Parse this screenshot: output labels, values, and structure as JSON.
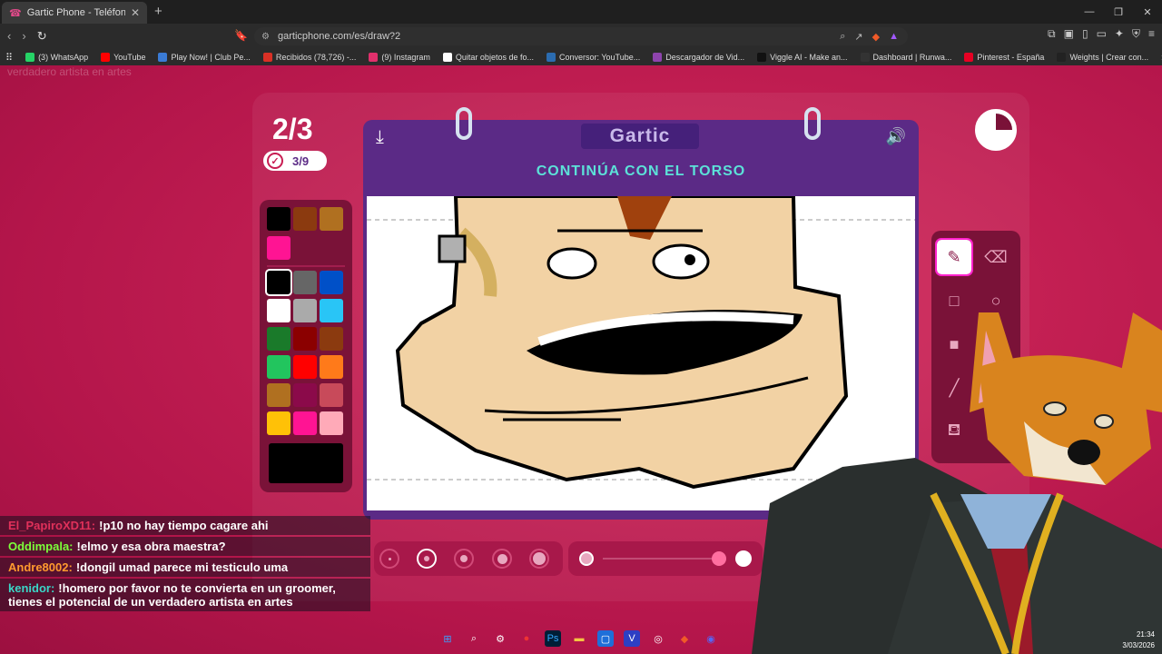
{
  "browser": {
    "tab_title": "Gartic Phone - Teléfono Descon",
    "url": "garticphone.com/es/draw?2",
    "bookmarks": [
      {
        "label": "(3) WhatsApp",
        "color": "#25d366"
      },
      {
        "label": "YouTube",
        "color": "#ff0000"
      },
      {
        "label": "Play Now! | Club Pe...",
        "color": "#3a7bd5"
      },
      {
        "label": "Recibidos (78,726) -...",
        "color": "#d93025"
      },
      {
        "label": "(9) Instagram",
        "color": "#e1306c"
      },
      {
        "label": "Quitar objetos de fo...",
        "color": "#ffffff"
      },
      {
        "label": "Conversor: YouTube...",
        "color": "#2b6cb0"
      },
      {
        "label": "Descargador de Vid...",
        "color": "#8e44ad"
      },
      {
        "label": "Viggle AI - Make an...",
        "color": "#111111"
      },
      {
        "label": "Dashboard | Runwa...",
        "color": "#333333"
      },
      {
        "label": "Pinterest - España",
        "color": "#e60023"
      },
      {
        "label": "Weights | Crear con...",
        "color": "#222222"
      }
    ]
  },
  "game": {
    "round": "2/3",
    "progress": "3/9",
    "logo": "Gartic",
    "instruction": "CONTINÚA CON EL TORSO",
    "timer_fraction_elapsed": 0.25,
    "palette_top": [
      "#000000",
      "#8b3a0f",
      "#b07020",
      "#ff1493"
    ],
    "palette_main": [
      "#000000",
      "#666666",
      "#0050c8",
      "#ffffff",
      "#aaaaaa",
      "#29c5f6",
      "#1a7a2a",
      "#8b0000",
      "#8b3a0f",
      "#22c55e",
      "#ff0000",
      "#ff7a1a",
      "#b07020",
      "#8b0a4a",
      "#c84a5a",
      "#ffc107",
      "#ff1493",
      "#ffaab8"
    ],
    "selected_color": "#000000",
    "brush_size_selected_index": 1
  },
  "chat": [
    {
      "user": "El_PapiroXD11:",
      "user_color": "#e0305a",
      "text": "!p10 no hay tiempo cagare ahi"
    },
    {
      "user": "Oddimpala:",
      "user_color": "#7cff3a",
      "text": "!elmo y esa obra maestra?"
    },
    {
      "user": "Andre8002:",
      "user_color": "#ff9a2e",
      "text": "!dongil umad parece mi testiculo uma"
    },
    {
      "user": "kenidor:",
      "user_color": "#3ad6c8",
      "text": "!homero por favor no te convierta en un groomer, tienes el potencial de un verdadero artista en artes"
    }
  ],
  "overlay_ghost": "verdadero artista en artes",
  "clock": {
    "time": "21:34",
    "date": "3/03/2026"
  }
}
